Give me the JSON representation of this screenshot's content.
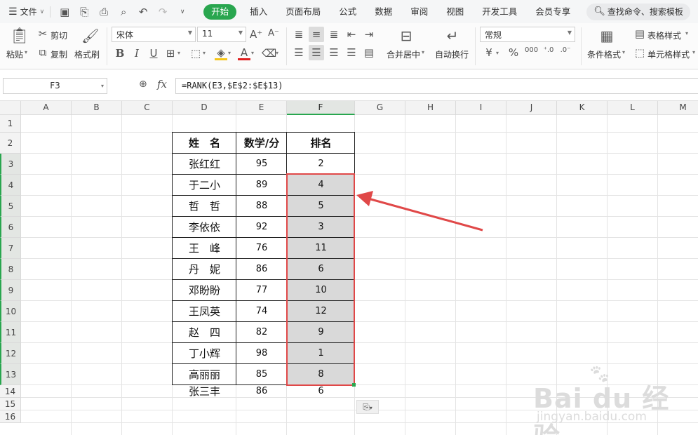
{
  "menubar": {
    "file_label": "文件",
    "tabs": [
      "开始",
      "插入",
      "页面布局",
      "公式",
      "数据",
      "审阅",
      "视图",
      "开发工具",
      "会员专享"
    ],
    "active_tab": "开始",
    "search_placeholder": "查找命令、搜索模板"
  },
  "ribbon": {
    "paste": "粘贴",
    "cut": "剪切",
    "copy": "复制",
    "format_painter": "格式刷",
    "font_name": "宋体",
    "font_size": "11",
    "merge_center": "合并居中",
    "wrap_text": "自动换行",
    "number_format": "常规",
    "conditional_format": "条件格式",
    "table_style": "表格样式",
    "cell_style": "单元格样式",
    "bold": "B",
    "italic": "I",
    "underline": "U"
  },
  "formula_bar": {
    "name_box": "F3",
    "fx": "fx",
    "formula": "=RANK(E3,$E$2:$E$13)"
  },
  "sheet": {
    "columns": [
      "A",
      "B",
      "C",
      "D",
      "E",
      "F",
      "G",
      "H",
      "I",
      "J",
      "K",
      "L",
      "M"
    ],
    "selected_column": "F",
    "rows": [
      "1",
      "2",
      "3",
      "4",
      "5",
      "6",
      "7",
      "8",
      "9",
      "10",
      "11",
      "12",
      "13",
      "14",
      "15",
      "16"
    ],
    "table_headers": [
      "姓　名",
      "数学/分",
      "排名"
    ],
    "table_rows": [
      {
        "name": "张红红",
        "math": "95",
        "rank": "2"
      },
      {
        "name": "于二小",
        "math": "89",
        "rank": "4"
      },
      {
        "name": "哲　哲",
        "math": "88",
        "rank": "5"
      },
      {
        "name": "李依依",
        "math": "92",
        "rank": "3"
      },
      {
        "name": "王　峰",
        "math": "76",
        "rank": "11"
      },
      {
        "name": "丹　妮",
        "math": "86",
        "rank": "6"
      },
      {
        "name": "邓盼盼",
        "math": "77",
        "rank": "10"
      },
      {
        "name": "王凤英",
        "math": "74",
        "rank": "12"
      },
      {
        "name": "赵　四",
        "math": "82",
        "rank": "9"
      },
      {
        "name": "丁小辉",
        "math": "98",
        "rank": "1"
      },
      {
        "name": "高丽丽",
        "math": "85",
        "rank": "8"
      },
      {
        "name": "张三丰",
        "math": "86",
        "rank": "6"
      }
    ]
  },
  "watermark": {
    "brand": "Bai du 经验",
    "url": "jingyan.baidu.com"
  },
  "colors": {
    "accent_green": "#29a64f",
    "annotation_red": "#e04848",
    "selection_gray": "#d9d9d9"
  }
}
